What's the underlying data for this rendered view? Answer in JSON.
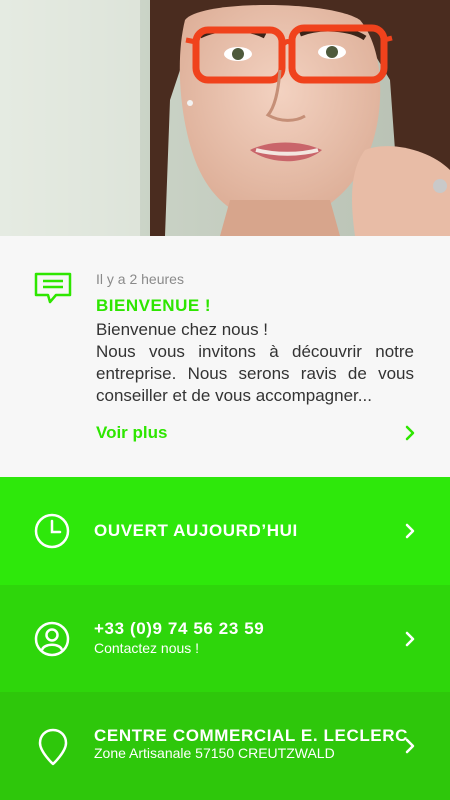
{
  "hero": {
    "image": "woman-with-orange-glasses-photo"
  },
  "message": {
    "icon": "message-icon",
    "time": "Il y a 2 heures",
    "title": "BIENVENUE !",
    "line1": "Bienvenue chez nous !",
    "body": "Nous vous invitons à découvrir notre entreprise. Nous serons ravis de vous conseiller et de vous accompagner...",
    "more_label": "Voir plus"
  },
  "hours": {
    "icon": "clock-icon",
    "title": "OUVERT AUJOURD’HUI",
    "color": "#2ee80b"
  },
  "contact": {
    "icon": "user-icon",
    "phone": "+33 (0)9 74 56 23 59",
    "subtitle": "Contactez nous !",
    "color": "#2ed60b"
  },
  "location": {
    "icon": "location-pin-icon",
    "title": "CENTRE COMMERCIAL E. LECLERC",
    "address": "Zone Artisanale 57150 CREUTZWALD",
    "color": "#2ec70b"
  },
  "colors": {
    "accent": "#2ee600"
  }
}
